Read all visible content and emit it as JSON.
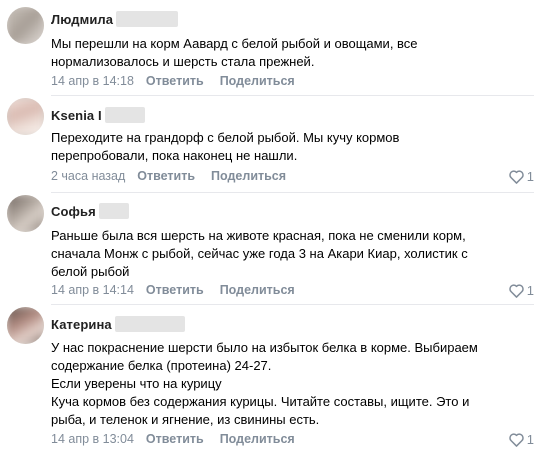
{
  "colors": {
    "meta": "#818c99",
    "name": "#222222",
    "text": "#000000",
    "divider": "#e7e8ec"
  },
  "actions": {
    "reply": "Ответить",
    "share": "Поделиться"
  },
  "comments": [
    {
      "name": "Людмила",
      "lines": [
        "Мы перешли на корм Аавард с белой рыбой и овощами, все",
        "нормализовалось и шерсть стала прежней."
      ],
      "date": "14 апр в 14:18",
      "likes": ""
    },
    {
      "name": "Ksenia I",
      "lines": [
        "Переходите на грандорф с белой рыбой. Мы кучу кормов",
        "перепробовали, пока наконец не нашли."
      ],
      "date": "2 часа назад",
      "likes": "1"
    },
    {
      "name": "Софья",
      "lines": [
        "Раньше была вся шерсть на животе красная, пока не сменили корм,",
        "сначала Монж с рыбой, сейчас уже года 3 на Акари Киар, холистик с",
        "белой рыбой"
      ],
      "date": "14 апр в 14:14",
      "likes": "1"
    },
    {
      "name": "Катерина",
      "lines": [
        "У нас покраснение шерсти было на избыток белка в корме. Выбираем",
        "содержание белка (протеина) 24-27.",
        "Если уверены что на курицу",
        "Куча кормов без содержания курицы. Читайте составы, ищите. Это и",
        "рыба, и теленок и ягнение, из свинины есть."
      ],
      "date": "14 апр в 13:04",
      "likes": "1"
    }
  ]
}
